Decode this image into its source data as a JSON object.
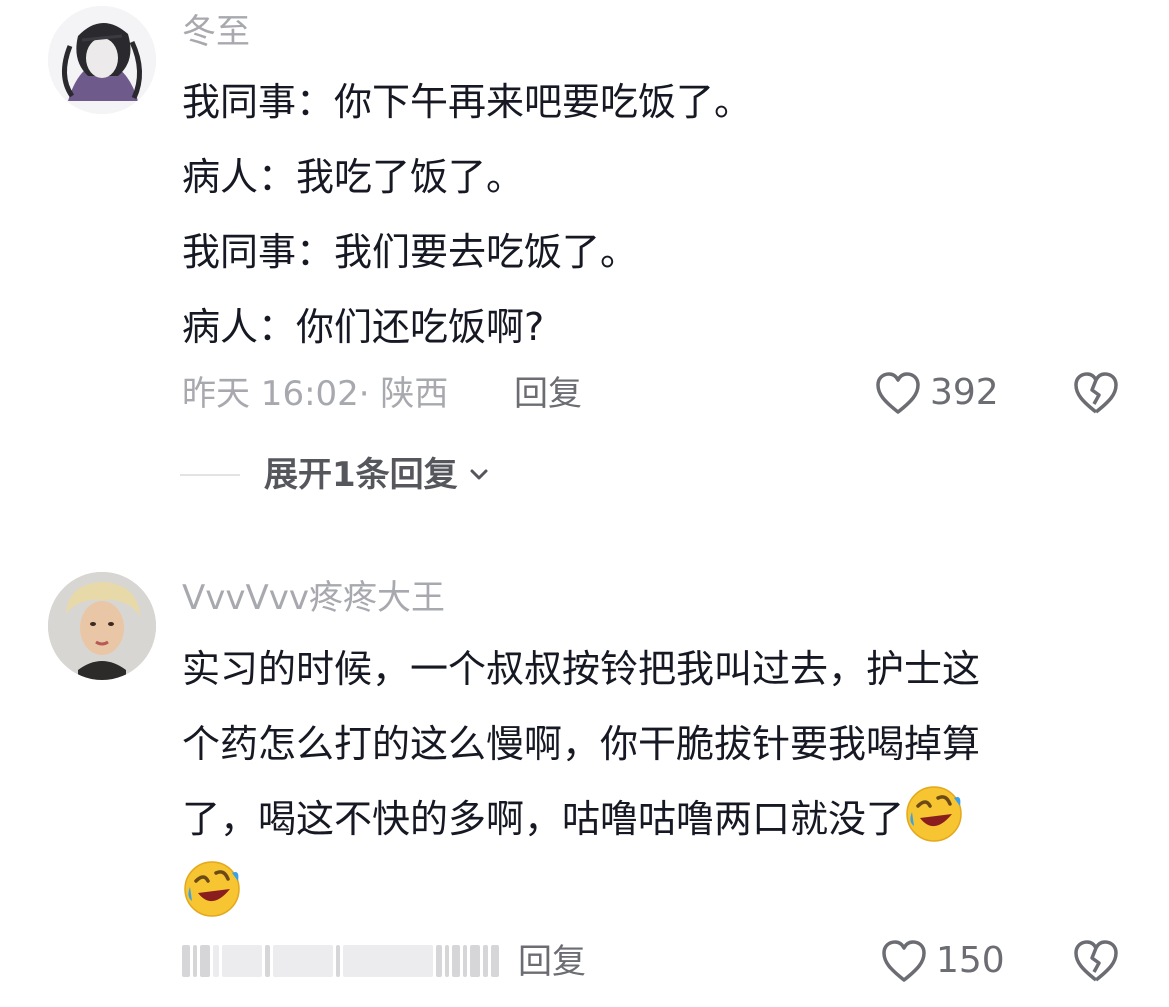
{
  "comments": [
    {
      "username": "冬至",
      "lines": [
        "我同事：你下午再来吧要吃饭了。",
        "病人：我吃了饭了。",
        "我同事：我们要去吃饭了。",
        "病人：你们还吃饭啊?"
      ],
      "meta": "昨天 16:02· 陕西",
      "reply_label": "回复",
      "likes": "392",
      "expand_label": "展开1条回复"
    },
    {
      "username": "VvvVvv疼疼大王",
      "lines": [
        "实习的时候，一个叔叔按铃把我叫过去，护士这",
        "个药怎么打的这么慢啊，你干脆拔针要我喝掉算",
        "了，喝这不快的多啊，咕噜咕噜两口就没了"
      ],
      "emoji": "rolling-on-floor-laughing-emoji",
      "reply_label": "回复",
      "likes": "150"
    }
  ],
  "colors": {
    "primary_text": "#161823",
    "secondary_text": "#a7a9ae",
    "action_text": "#6b6d73"
  }
}
